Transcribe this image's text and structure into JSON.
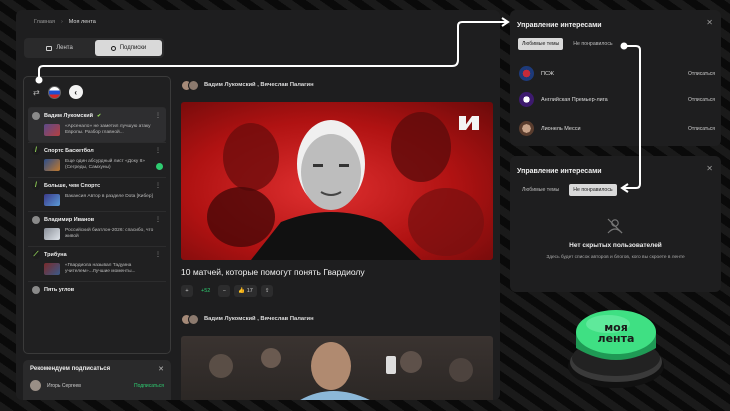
{
  "breadcrumb": {
    "home": "Главная",
    "current": "Моя лента"
  },
  "tabs": [
    {
      "label": "Лента"
    },
    {
      "label": "Подписки"
    }
  ],
  "sidebar": {
    "items": [
      {
        "name": "Вадим Лукомский",
        "text": "«Арсенало» не заметил лучшую атаку Европы. Разбор главной..."
      },
      {
        "name": "Спортс Баскетбол",
        "text": "Еще один абсурдный лист «Доку 8» (Сегреды, Самхуны)"
      },
      {
        "name": "Больше, чем Спортс",
        "text": "Вакансия Автор в разделе Dota [Кибер]"
      },
      {
        "name": "Владимир Иванов",
        "text": "Российский биатлон-2026: спасибо, что живой"
      },
      {
        "name": "Трибуна",
        "text": "«Гвардиола называл Тадуина учителем»...Лучшие моменты..."
      },
      {
        "name": "Пять углов",
        "text": ""
      }
    ]
  },
  "recommend": {
    "title": "Рекомендуем подписаться",
    "user": "Игорь Сергеев",
    "action": "Подписаться"
  },
  "feed": {
    "authors": "Вадим Лукомский , Вячеслав Палагин",
    "post_title": "10 матчей, которые помогут понять Гвардиолу",
    "reactions": {
      "plus": "+",
      "score": "+52",
      "minus": "−",
      "likes": "👍 17"
    },
    "authors2": "Вадим Лукомский , Вячеслав Палагин"
  },
  "panel_interests": {
    "title": "Управление интересами",
    "tab_fav": "Любимые темы",
    "tab_disliked": "Не понравилось",
    "rows": [
      {
        "name": "ПСЖ",
        "action": "Отписаться"
      },
      {
        "name": "Английская Премьер-лига",
        "action": "Отписаться"
      },
      {
        "name": "Лионель Месси",
        "action": "Отписаться"
      }
    ]
  },
  "panel_hidden": {
    "title": "Управление интересами",
    "tab_fav": "Любимые темы",
    "tab_disliked": "Не понравилось",
    "empty_title": "Нет скрытых пользователей",
    "empty_sub": "Здесь будет список авторов и блогов, кого вы скроете в ленте"
  },
  "button3d": {
    "line1": "моя",
    "line2": "лента"
  },
  "colors": {
    "accent": "#2ecc71",
    "hero_red": "#c41a1a",
    "panel_bg": "#1e1e1f"
  }
}
